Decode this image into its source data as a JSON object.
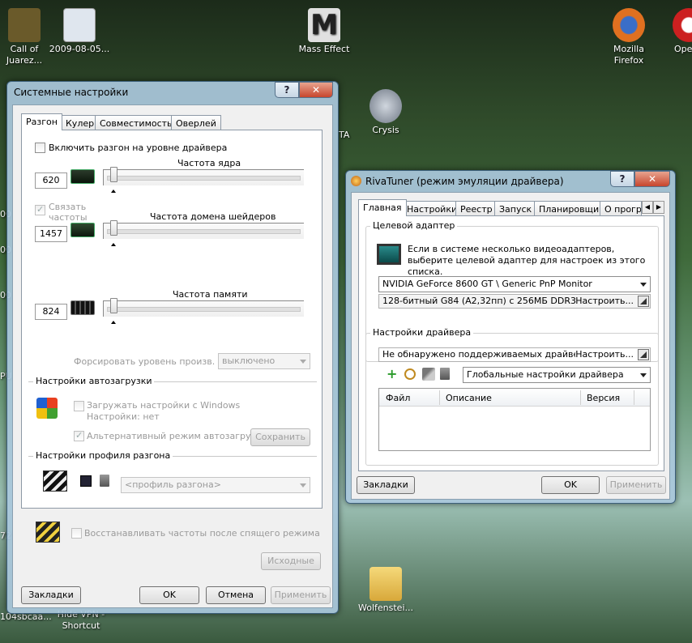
{
  "desktop": {
    "icons": [
      {
        "label": "Call of\nJuarez...",
        "color": "#6a5a2a"
      },
      {
        "label": "2009-08-05...",
        "color": "#dfe6ee"
      },
      {
        "label": "Mass Effect",
        "color": "#e0e0e0"
      },
      {
        "label": "Crysis",
        "color": "#9aa3b0"
      },
      {
        "label": "Mozilla\nFirefox",
        "color": "#e07020"
      },
      {
        "label": "Ope",
        "color": "#cc2020"
      },
      {
        "label": "Wolfenstei...",
        "color": "#e8c44a"
      },
      {
        "label": "Hide VPN -\nShortcut",
        "color": "#4a6a8a"
      }
    ],
    "edge_fragments": [
      "00",
      "00",
      "00",
      "PU",
      "72",
      "104sbcaa...",
      "TA"
    ]
  },
  "sys_window": {
    "title": "Системные настройки",
    "help_label": "?",
    "close_label": "✕",
    "tabs": [
      "Разгон",
      "Кулер",
      "Совместимость",
      "Оверлей"
    ],
    "enable_oc_label": "Включить разгон на уровне драйвера",
    "core_title": "Частота ядра",
    "core_value": "620",
    "link_label": "Связать\nчастоты",
    "shader_title": "Частота домена шейдеров",
    "shader_value": "1457",
    "mem_title": "Частота памяти",
    "mem_value": "824",
    "force_label": "Форсировать уровень произв.",
    "force_value": "выключено",
    "autoload_section": "Настройки автозагрузки",
    "load_windows_label": "Загружать настройки с Windows",
    "settings_none": "Настройки: нет",
    "alt_mode_label": "Альтернативный режим автозагрузки",
    "save_label": "Сохранить",
    "profile_section": "Настройки профиля разгона",
    "profile_placeholder": "<профиль разгона>",
    "restore_label": "Восстанавливать частоты после спящего режима",
    "defaults_label": "Исходные",
    "bookmarks_label": "Закладки",
    "ok_label": "OK",
    "cancel_label": "Отмена",
    "apply_label": "Применить"
  },
  "riva_window": {
    "title": "RivaTuner (режим эмуляции драйвера)",
    "help_label": "?",
    "close_label": "✕",
    "tabs": [
      "Главная",
      "Настройки",
      "Реестр",
      "Запуск",
      "Планировщик",
      "О прогр..."
    ],
    "target_section": "Целевой адаптер",
    "target_desc": "Если в системе несколько видеоадаптеров, выберите целевой адаптер для настроек из этого списка.",
    "adapter_value": "NVIDIA GeForce 8600 GT  \\ Generic PnP Monitor",
    "adapter_info": "128-битный G84 (A2,32пп) с 256МБ DDR3",
    "configure_label": "Настроить...",
    "driver_section": "Настройки драйвера",
    "driver_info": "Не обнаружено поддерживаемых драйверов дл",
    "driver_configure": "Настроить...",
    "driver_combo": "Глобальные настройки драйвера",
    "columns": [
      "Файл",
      "Описание",
      "Версия"
    ],
    "bookmarks_label": "Закладки",
    "ok_label": "OK",
    "apply_label": "Применить"
  }
}
